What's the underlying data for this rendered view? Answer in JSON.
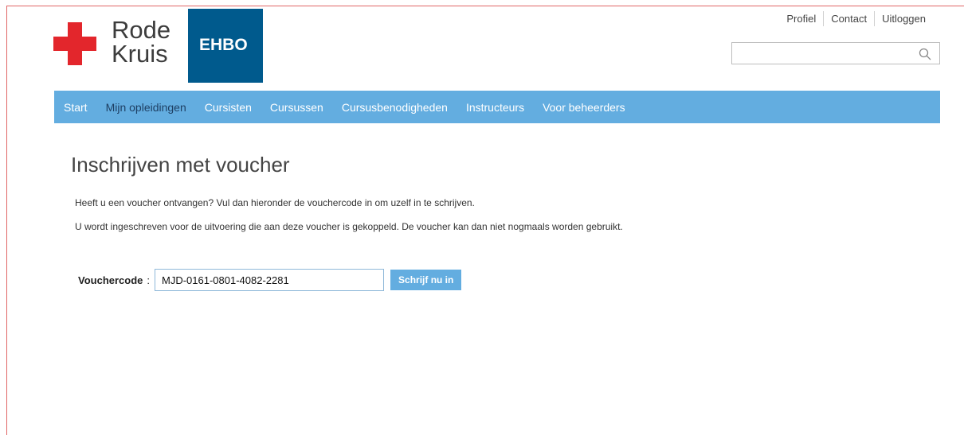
{
  "brand": {
    "line1": "Rode",
    "line2": "Kruis",
    "badge": "EHBO",
    "cross_color": "#e3262c",
    "badge_color": "#005a8d"
  },
  "toplinks": {
    "profile": "Profiel",
    "contact": "Contact",
    "logout": "Uitloggen"
  },
  "search": {
    "value": "",
    "placeholder": ""
  },
  "nav": {
    "color": "#63ade0",
    "items": [
      {
        "label": "Start"
      },
      {
        "label": "Mijn opleidingen"
      },
      {
        "label": "Cursisten"
      },
      {
        "label": "Cursussen"
      },
      {
        "label": "Cursusbenodigheden"
      },
      {
        "label": "Instructeurs"
      },
      {
        "label": "Voor beheerders"
      }
    ],
    "active_index": 1
  },
  "main": {
    "title": "Inschrijven met voucher",
    "paragraph1": "Heeft u een voucher ontvangen? Vul dan hieronder de vouchercode in om uzelf in te schrijven.",
    "paragraph2": "U wordt ingeschreven voor de uitvoering die aan deze voucher is gekoppeld. De voucher kan dan niet nogmaals worden gebruikt.",
    "voucher_label": "Vouchercode",
    "colon": ":",
    "voucher_value": "MJD-0161-0801-4082-2281",
    "submit_label": "Schrijf nu in"
  }
}
